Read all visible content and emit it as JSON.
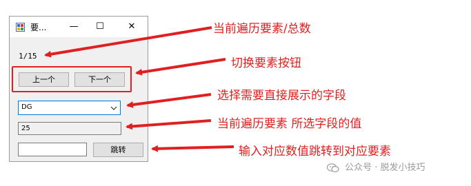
{
  "window": {
    "title": "要...",
    "minimize_glyph": "—",
    "maximize_glyph": "☐",
    "close_glyph": "✕"
  },
  "counter": "1/15",
  "buttons": {
    "prev": "上一个",
    "next": "下一个",
    "jump": "跳转"
  },
  "field_select": {
    "selected": "DG"
  },
  "field_value": "25",
  "index_input": {
    "value": ""
  },
  "annotations": {
    "counter": "当前遍历要素/总数",
    "switch": "切换要素按钮",
    "select_field": "选择需要直接展示的字段",
    "field_value": "当前遍历要素 所选字段的值",
    "jump": "输入对应数值跳转到对应要素"
  },
  "watermark": "公众号 · 脱发小技巧",
  "colors": {
    "annotation": "#e02020",
    "focus_border": "#0078d7"
  },
  "icons": {
    "app": "app-window-icon",
    "dropdown": "chevron-down-icon",
    "watermark": "wechat-icon"
  }
}
